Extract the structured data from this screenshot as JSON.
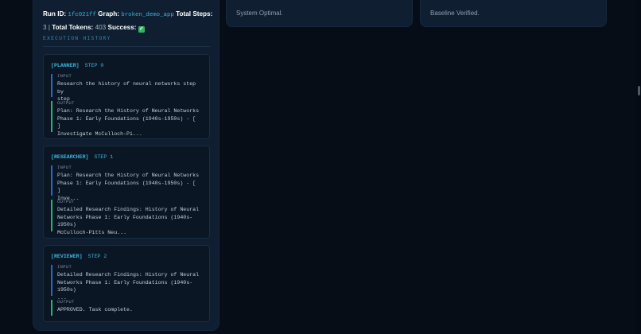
{
  "run": {
    "run_id_label": "Run ID:",
    "run_id": "1fc021ff",
    "graph_label": "Graph:",
    "graph": "broken_demo_app",
    "total_steps_label": "Total Steps:",
    "total_steps": "3",
    "separator": "|",
    "total_tokens_label": "Total Tokens:",
    "total_tokens": "403",
    "success_label": "Success:",
    "success_icon": "check-icon",
    "success_value": "✓"
  },
  "history_title": "EXECUTION HISTORY",
  "steps": [
    {
      "role": "[PLANNER]",
      "step": "STEP 0",
      "input_label": "INPUT",
      "input": "Research the history of neural networks step by\nstep",
      "output_label": "OUTPUT",
      "output": "Plan: Research the History of Neural Networks\nPhase 1: Early Foundations (1940s-1950s) - [ ]\nInvestigate McCulloch-Pi..."
    },
    {
      "role": "[RESEARCHER]",
      "step": "STEP 1",
      "input_label": "INPUT",
      "input": "Plan: Research the History of Neural Networks\nPhase 1: Early Foundations (1940s-1950s) - [ ]\nInve...",
      "output_label": "OUTPUT",
      "output": "Detailed Research Findings: History of Neural\nNetworks Phase 1: Early Foundations (1940s-1950s)\nMcCulloch-Pitts Neu..."
    },
    {
      "role": "[REVIEWER]",
      "step": "STEP 2",
      "input_label": "INPUT",
      "input": "Detailed Research Findings: History of Neural\nNetworks Phase 1: Early Foundations (1940s-1950s)\n...",
      "output_label": "OUTPUT",
      "output": "APPROVED. Task complete."
    }
  ],
  "status_cards": [
    {
      "text": "System Optimal."
    },
    {
      "text": "Baseline Verified."
    }
  ],
  "colors": {
    "background": "#070d17",
    "panel": "#0f1e30",
    "accent": "#39b6dd",
    "input_bar": "#2a66c7",
    "output_bar": "#2bb36a",
    "success": "#2fb55a"
  }
}
